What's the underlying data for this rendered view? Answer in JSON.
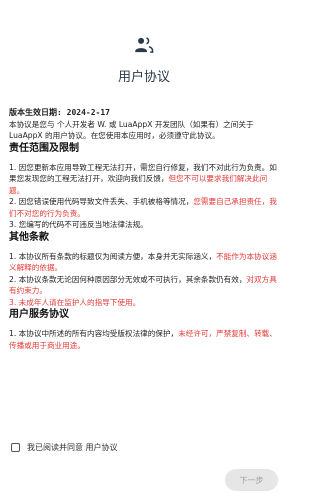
{
  "header": {
    "icon": "users-icon",
    "title": "用户协议"
  },
  "content": {
    "date_line": "版本生效日期: 2024-2-17",
    "intro": "本协议是您与 个人开发者 W. 或 LuaAppX 开发团队（如果有）之间关于 LuaAppX 的用户协议。在您使用本应用时，必须遵守此协议。",
    "sections": [
      {
        "title": "责任范围及限制",
        "items": [
          {
            "normal": "1. 因您更新本应用导致工程无法打开，需您自行修复，我们不对此行为负责。如果您发现您的工程无法打开，欢迎向我们反馈，",
            "red": "但您不可以要求我们解决此问题。"
          },
          {
            "normal": "2. 因您错误使用代码导致文件丢失、手机被格等情况，",
            "red": "您需要自己承担责任，我们不对您的行为负责。"
          },
          {
            "normal": "3. 您编写的代码不可违反当地法律法规。",
            "red": ""
          }
        ]
      },
      {
        "title": "其他条款",
        "items": [
          {
            "normal": "1. 本协议所有条款的标题仅为阅读方便，本身并无实际涵义，",
            "red": "不能作为本协议涵义解释的依据。"
          },
          {
            "normal": "2. 本协议条款无论因何种原因部分无效或不可执行，其余条款仍有效，",
            "red": "对双方具有约束力。"
          },
          {
            "normal": "",
            "red": "3. 未成年人请在监护人的指导下使用。"
          }
        ]
      },
      {
        "title": "用户服务协议",
        "items": [
          {
            "normal": "1. 本协议中所述的所有内容均受版权法律的保护，",
            "red": "未经许可，严禁复制、转载、传播或用于商业用途。"
          }
        ]
      }
    ]
  },
  "footer": {
    "agree_label": "我已阅读并同意 用户协议",
    "checked": false,
    "next_label": "下一步"
  },
  "colors": {
    "accent_red": "#e53935",
    "title": "#2b3a4a",
    "button_disabled_bg": "#e6e6e6"
  }
}
